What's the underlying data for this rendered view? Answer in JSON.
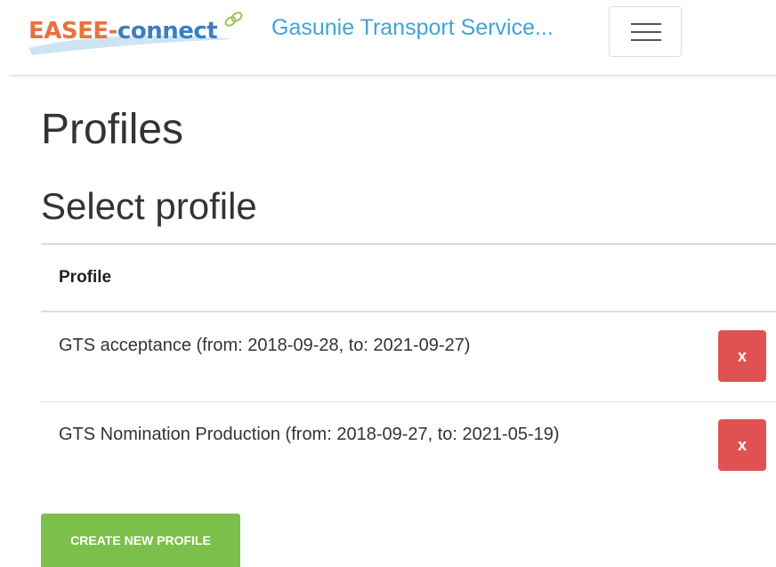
{
  "brand": {
    "logo_text_part1": "EASEE-",
    "logo_text_part2": "connect",
    "organization": "Gasunie Transport Service..."
  },
  "page": {
    "title": "Profiles",
    "subtitle": "Select profile"
  },
  "table": {
    "header": "Profile",
    "rows": [
      {
        "label": "GTS acceptance (from: 2018-09-28, to: 2021-09-27)",
        "delete_label": "x"
      },
      {
        "label": "GTS Nomination Production (from: 2018-09-27, to: 2021-05-19)",
        "delete_label": "x"
      }
    ]
  },
  "actions": {
    "create_label": "CREATE NEW PROFILE"
  },
  "colors": {
    "brand_orange": "#e8723c",
    "brand_blue": "#3a7fc0",
    "org_link": "#3fa4d6",
    "delete_red": "#e05252",
    "create_green": "#7cc04b"
  },
  "icons": {
    "menu": "hamburger-menu-icon",
    "logo_chain": "chain-link-icon"
  }
}
